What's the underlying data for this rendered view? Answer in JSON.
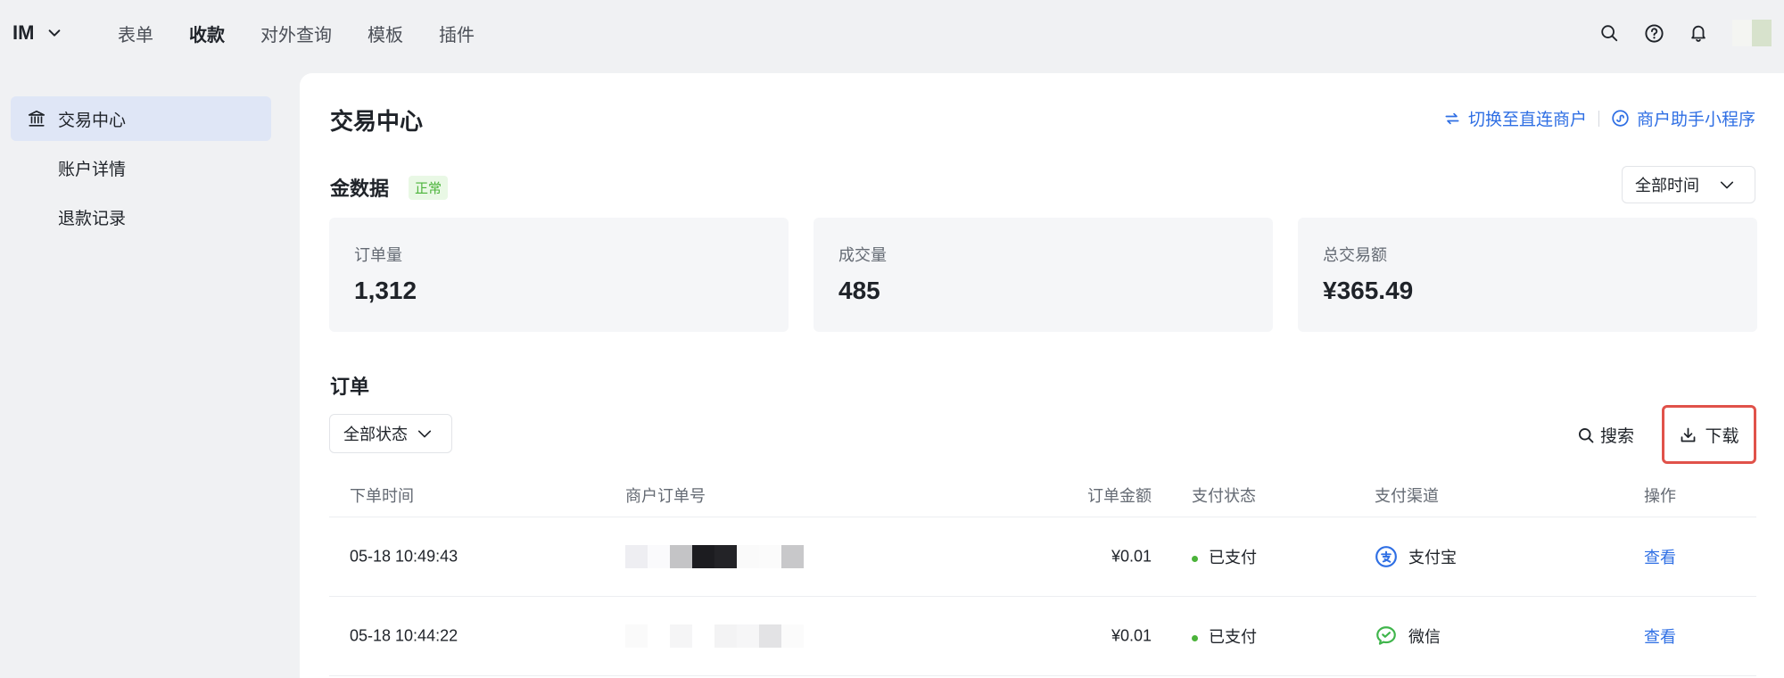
{
  "app": {
    "brand": "IM"
  },
  "nav": {
    "items": [
      "表单",
      "收款",
      "对外查询",
      "模板",
      "插件"
    ],
    "active_index": 1
  },
  "top_icons": [
    "search-icon",
    "help-icon",
    "bell-icon"
  ],
  "sidebar": {
    "items": [
      {
        "label": "交易中心",
        "active": true
      },
      {
        "label": "账户详情",
        "active": false
      },
      {
        "label": "退款记录",
        "active": false
      }
    ]
  },
  "page": {
    "title": "交易中心",
    "link_switch": "切换至直连商户",
    "link_miniapp": "商户助手小程序"
  },
  "summary": {
    "title": "金数据",
    "status_badge": "正常",
    "time_filter": "全部时间",
    "stats": [
      {
        "label": "订单量",
        "value": "1,312"
      },
      {
        "label": "成交量",
        "value": "485"
      },
      {
        "label": "总交易额",
        "value": "¥365.49"
      }
    ]
  },
  "orders": {
    "title": "订单",
    "status_filter": "全部状态",
    "search_label": "搜索",
    "download_label": "下载",
    "columns": [
      "下单时间",
      "商户订单号",
      "订单金额",
      "支付状态",
      "支付渠道",
      "操作"
    ],
    "rows": [
      {
        "time": "05-18 10:49:43",
        "amount": "¥0.01",
        "status": "已支付",
        "channel": "支付宝",
        "channel_icon": "alipay-icon",
        "action": "查看"
      },
      {
        "time": "05-18 10:44:22",
        "amount": "¥0.01",
        "status": "已支付",
        "channel": "微信",
        "channel_icon": "wechat-icon",
        "action": "查看"
      }
    ]
  },
  "colors": {
    "accent": "#2f6fe4",
    "success": "#4bb33a",
    "highlight_border": "#e0524a",
    "sidebar_active": "#dfe6f6"
  }
}
